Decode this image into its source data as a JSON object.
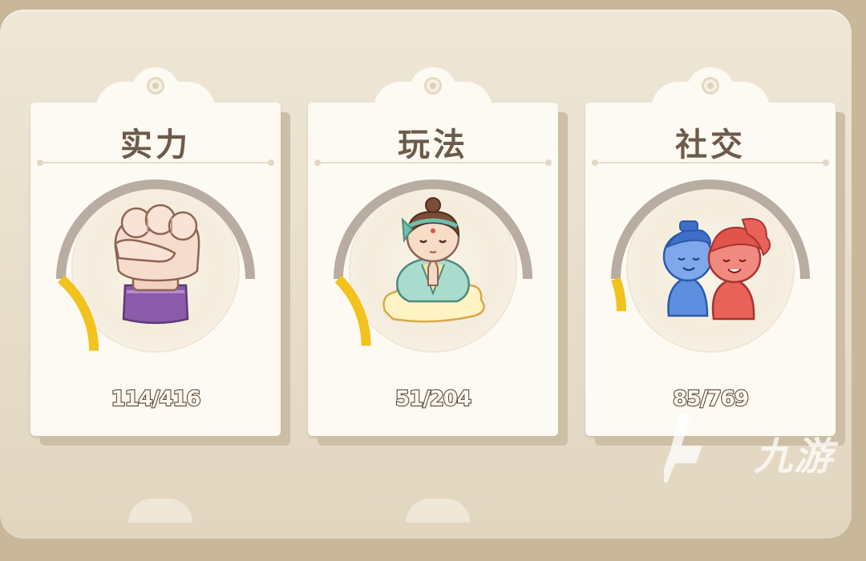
{
  "cards": [
    {
      "title": "实力",
      "icon": "fist-icon",
      "current": 114,
      "total": 416,
      "progress_text": "114/416"
    },
    {
      "title": "玩法",
      "icon": "meditating-monk-icon",
      "current": 51,
      "total": 204,
      "progress_text": "51/204"
    },
    {
      "title": "社交",
      "icon": "blue-red-couple-icon",
      "current": 85,
      "total": 769,
      "progress_text": "85/769"
    }
  ],
  "watermark": {
    "text": "九游"
  },
  "colors": {
    "gauge_fill": "#f2c21d",
    "gauge_track": "#b8aca3",
    "card_bg": "#fcfaf3",
    "title_text": "#6e5a4b"
  }
}
